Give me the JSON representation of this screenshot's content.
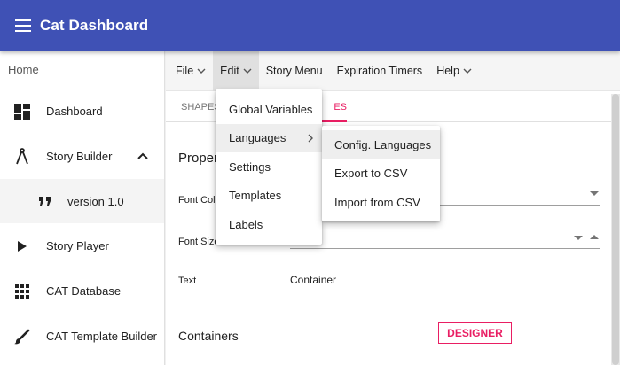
{
  "app": {
    "title": "Cat Dashboard"
  },
  "sidebar": {
    "home": "Home",
    "items": [
      {
        "label": "Dashboard",
        "icon": "dashboard-icon"
      },
      {
        "label": "Story Builder",
        "icon": "compass-icon",
        "expanded": true
      },
      {
        "label": "version 1.0",
        "icon": "quote-icon"
      },
      {
        "label": "Story Player",
        "icon": "play-icon"
      },
      {
        "label": "CAT Database",
        "icon": "grid-icon"
      },
      {
        "label": "CAT Template Builder",
        "icon": "brush-icon"
      }
    ]
  },
  "menubar": {
    "items": [
      {
        "label": "File"
      },
      {
        "label": "Edit"
      },
      {
        "label": "Story Menu"
      },
      {
        "label": "Expiration Timers"
      },
      {
        "label": "Help"
      }
    ]
  },
  "edit_menu": {
    "items": [
      "Global Variables",
      "Languages",
      "Settings",
      "Templates",
      "Labels"
    ]
  },
  "languages_submenu": {
    "items": [
      "Config. Languages",
      "Export to CSV",
      "Import from CSV"
    ]
  },
  "content": {
    "tabs": [
      "SHAPES",
      "ES"
    ],
    "section_title": "Proper",
    "font_color_label": "Font Colo",
    "font_size_label": "Font Size",
    "text_label": "Text",
    "text_value": "Container",
    "containers_title": "Containers",
    "designer_button": "DESIGNER"
  },
  "colors": {
    "appbar": "#3f51b5",
    "accent": "#e91e63"
  }
}
